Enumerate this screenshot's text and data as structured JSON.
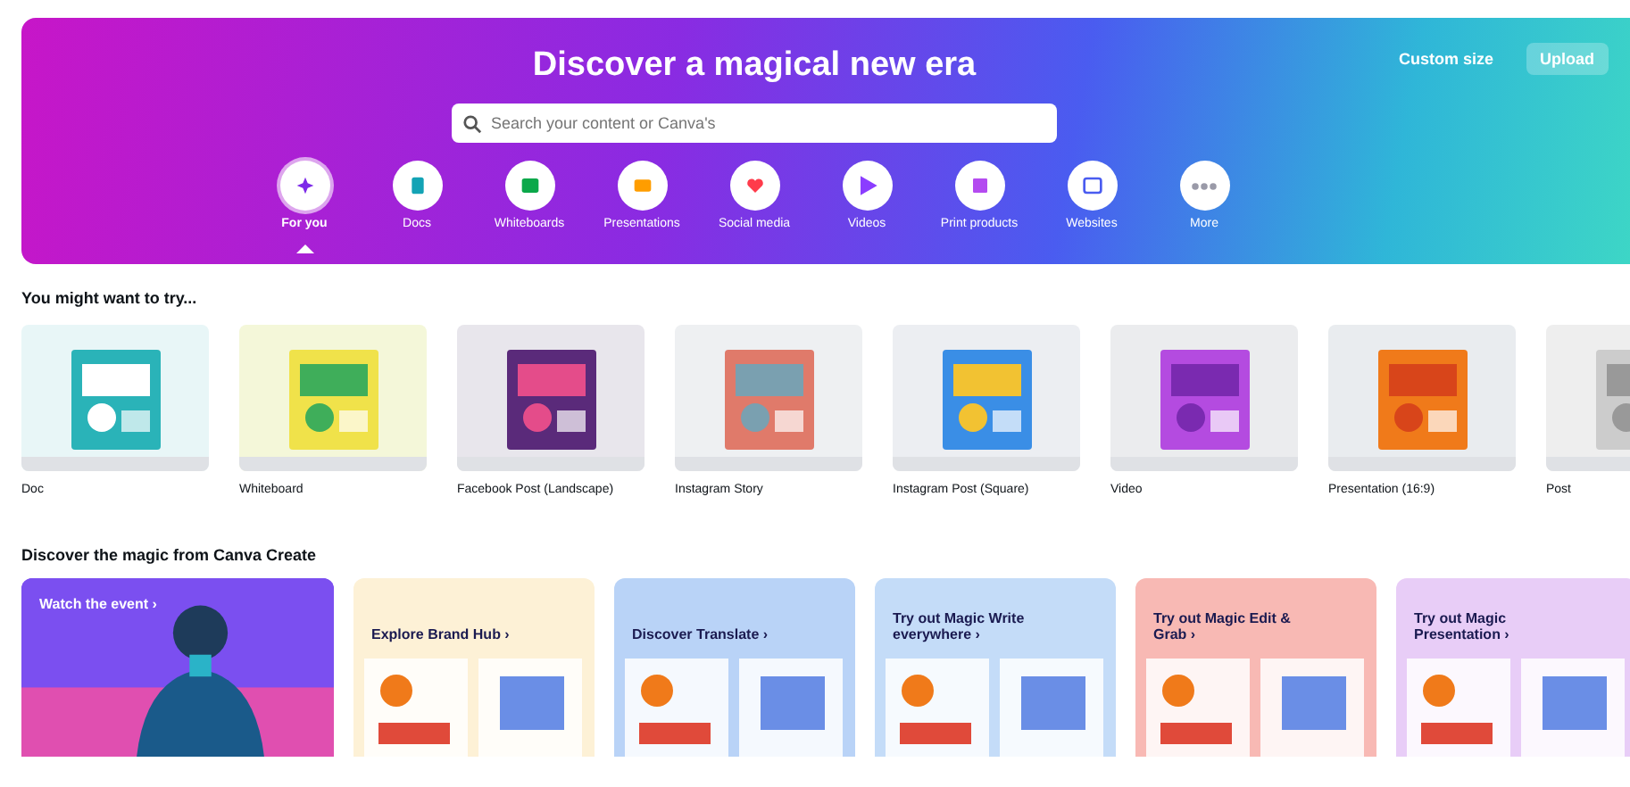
{
  "hero": {
    "title": "Discover a magical new era",
    "actions": [
      "Custom size",
      "Upload"
    ],
    "search": {
      "placeholder": "Search your content or Canva's"
    },
    "categories": [
      {
        "label": "For you",
        "selected": true,
        "color": "#7d2ae8"
      },
      {
        "label": "Docs",
        "selected": false,
        "color": "#13a3b5"
      },
      {
        "label": "Whiteboards",
        "selected": false,
        "color": "#0ba84a"
      },
      {
        "label": "Presentations",
        "selected": false,
        "color": "#ff9d00"
      },
      {
        "label": "Social media",
        "selected": false,
        "color": "#ff3b4b"
      },
      {
        "label": "Videos",
        "selected": false,
        "color": "#8b3dff"
      },
      {
        "label": "Print products",
        "selected": false,
        "color": "#b44bf0"
      },
      {
        "label": "Websites",
        "selected": false,
        "color": "#4a5cf0"
      },
      {
        "label": "More",
        "selected": false,
        "color": "#9a9aa8"
      }
    ]
  },
  "suggestions": {
    "heading": "You might want to try...",
    "items": [
      {
        "label": "Doc",
        "kind": "picture"
      },
      {
        "label": "Whiteboard",
        "kind": "picture"
      },
      {
        "label": "Facebook Post (Landscape)",
        "kind": "picture"
      },
      {
        "label": "Instagram Story",
        "kind": "picture"
      },
      {
        "label": "Instagram Post (Square)",
        "kind": "picture"
      },
      {
        "label": "Video",
        "kind": "picture"
      },
      {
        "label": "Presentation (16:9)",
        "kind": "picture"
      },
      {
        "label": "Post",
        "kind": "picture"
      }
    ]
  },
  "discover": {
    "heading": "Discover the magic from Canva Create",
    "cards": [
      {
        "title": "Watch the event ›",
        "color": "#7b4ff0"
      },
      {
        "title": "Explore Brand Hub ›",
        "color": "#fdf1d6"
      },
      {
        "title": "Discover Translate ›",
        "color": "#b9d3f7"
      },
      {
        "title": "Try out Magic Write everywhere ›",
        "color": "#c4dcf8"
      },
      {
        "title": "Try out Magic Edit & Grab ›",
        "color": "#f8b9b4"
      },
      {
        "title": "Try out Magic Presentation ›",
        "color": "#e8cdf7"
      }
    ]
  }
}
